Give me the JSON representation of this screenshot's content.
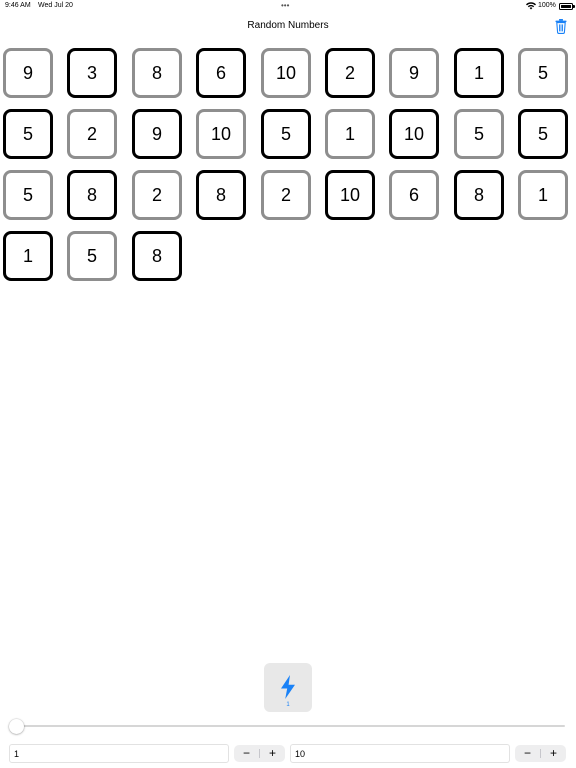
{
  "status_bar": {
    "time": "9:46 AM",
    "date": "Wed Jul 20",
    "multitask_dots": "•••",
    "battery": "100%"
  },
  "nav": {
    "title": "Random Numbers",
    "trash_icon": "trash-icon"
  },
  "colors": {
    "accent": "#1a82f7",
    "dark_border": "#000000",
    "light_border": "#8e8e8e",
    "button_bg": "#e8e8e8"
  },
  "numbers": [
    {
      "value": "9",
      "style": "light"
    },
    {
      "value": "3",
      "style": "dark"
    },
    {
      "value": "8",
      "style": "light"
    },
    {
      "value": "6",
      "style": "dark"
    },
    {
      "value": "10",
      "style": "light"
    },
    {
      "value": "2",
      "style": "dark"
    },
    {
      "value": "9",
      "style": "light"
    },
    {
      "value": "1",
      "style": "dark"
    },
    {
      "value": "5",
      "style": "light"
    },
    {
      "value": "5",
      "style": "dark"
    },
    {
      "value": "2",
      "style": "light"
    },
    {
      "value": "9",
      "style": "dark"
    },
    {
      "value": "10",
      "style": "light"
    },
    {
      "value": "5",
      "style": "dark"
    },
    {
      "value": "1",
      "style": "light"
    },
    {
      "value": "10",
      "style": "dark"
    },
    {
      "value": "5",
      "style": "light"
    },
    {
      "value": "5",
      "style": "dark"
    },
    {
      "value": "5",
      "style": "light"
    },
    {
      "value": "8",
      "style": "dark"
    },
    {
      "value": "2",
      "style": "light"
    },
    {
      "value": "8",
      "style": "dark"
    },
    {
      "value": "2",
      "style": "light"
    },
    {
      "value": "10",
      "style": "dark"
    },
    {
      "value": "6",
      "style": "light"
    },
    {
      "value": "8",
      "style": "dark"
    },
    {
      "value": "1",
      "style": "light"
    },
    {
      "value": "1",
      "style": "dark"
    },
    {
      "value": "5",
      "style": "light"
    },
    {
      "value": "8",
      "style": "dark"
    }
  ],
  "generate_button": {
    "icon": "bolt-icon",
    "count": "1"
  },
  "slider": {
    "value_fraction": 0.0
  },
  "min_field": {
    "value": "1",
    "minus": "−",
    "plus": "+"
  },
  "max_field": {
    "value": "10",
    "minus": "−",
    "plus": "+"
  }
}
